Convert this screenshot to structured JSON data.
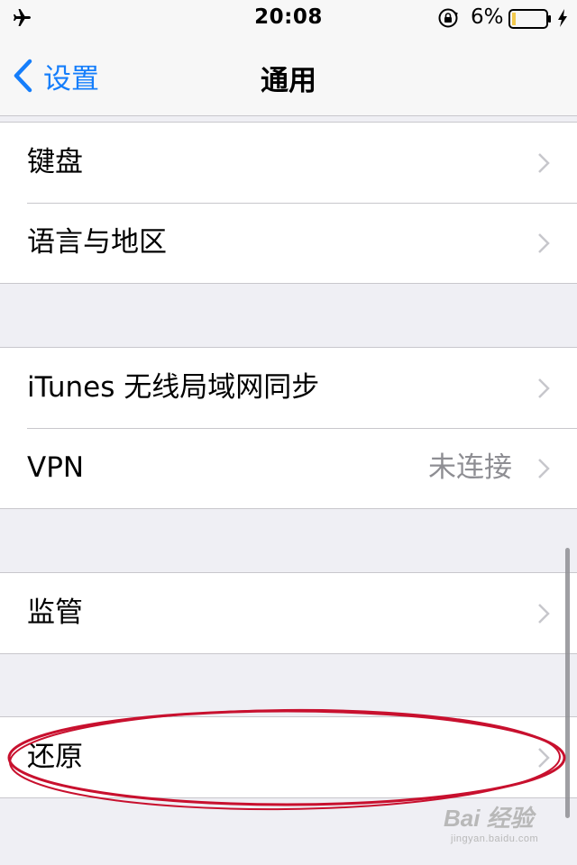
{
  "status_bar": {
    "time": "20:08",
    "battery_percent": "6%",
    "icons": [
      "airplane-mode-icon",
      "rotation-lock-icon",
      "battery-icon",
      "charging-bolt-icon"
    ]
  },
  "nav": {
    "back_label": "设置",
    "title": "通用"
  },
  "groups": [
    {
      "rows": [
        {
          "label": "键盘"
        },
        {
          "label": "语言与地区"
        }
      ]
    },
    {
      "rows": [
        {
          "label": "iTunes 无线局域网同步"
        },
        {
          "label": "VPN",
          "value": "未连接"
        }
      ]
    },
    {
      "rows": [
        {
          "label": "监管"
        }
      ]
    },
    {
      "rows": [
        {
          "label": "还原"
        }
      ]
    }
  ],
  "watermark": {
    "main": "Bai 经验",
    "sub": "jingyan.baidu.com"
  },
  "colors": {
    "accent": "#157efb",
    "background": "#efeff4",
    "annotation": "#c8102e",
    "secondary_text": "#8e8e93"
  }
}
